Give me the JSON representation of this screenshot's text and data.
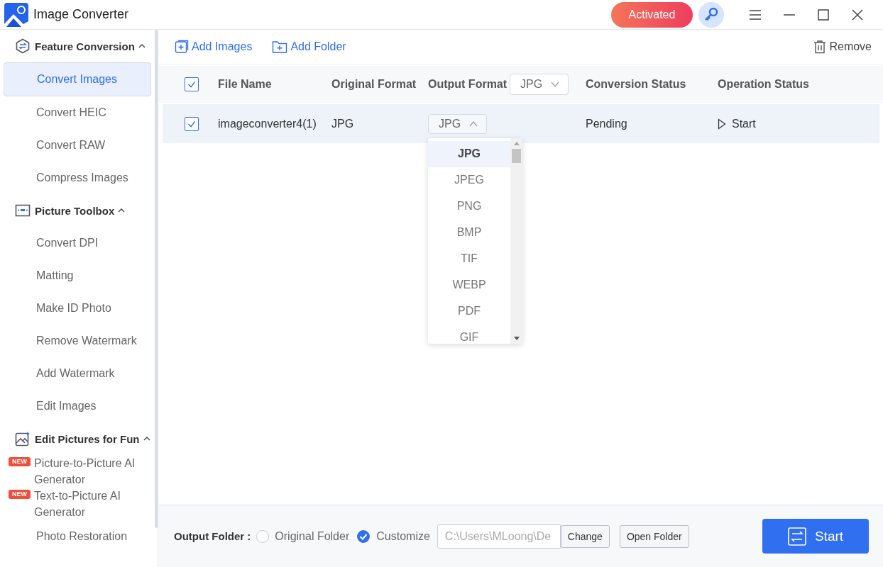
{
  "window": {
    "title": "Image Converter",
    "activated_label": "Activated"
  },
  "sidebar": {
    "sections": [
      {
        "title": "Feature Conversion",
        "expanded": true,
        "items": [
          {
            "label": "Convert Images",
            "selected": true
          },
          {
            "label": "Convert HEIC",
            "selected": false
          },
          {
            "label": "Convert RAW",
            "selected": false
          },
          {
            "label": "Compress Images",
            "selected": false
          }
        ]
      },
      {
        "title": "Picture Toolbox",
        "expanded": true,
        "items": [
          {
            "label": "Convert DPI",
            "selected": false
          },
          {
            "label": "Matting",
            "selected": false
          },
          {
            "label": "Make ID Photo",
            "selected": false
          },
          {
            "label": "Remove Watermark",
            "selected": false
          },
          {
            "label": "Add Watermark",
            "selected": false
          },
          {
            "label": "Edit Images",
            "selected": false
          }
        ]
      },
      {
        "title": "Edit Pictures for Fun",
        "expanded": true,
        "items": [
          {
            "label": "Picture-to-Picture AI Generator",
            "selected": false,
            "badge": "NEW"
          },
          {
            "label": "Text-to-Picture AI Generator",
            "selected": false,
            "badge": "NEW"
          },
          {
            "label": "Photo Restoration",
            "selected": false
          }
        ]
      }
    ]
  },
  "toolbar": {
    "add_images": "Add Images",
    "add_folder": "Add Folder",
    "remove": "Remove"
  },
  "table": {
    "all_checked": true,
    "columns": [
      "File Name",
      "Original Format",
      "Output Format",
      "Conversion Status",
      "Operation Status"
    ],
    "output_format_select": "JPG",
    "rows": [
      {
        "checked": true,
        "file_name": "imageconverter4(1)",
        "original_format": "JPG",
        "output_format": "JPG",
        "dropdown_open": true,
        "status": "Pending",
        "operation": "Start"
      }
    ]
  },
  "format_menu": {
    "options": [
      {
        "label": "JPG",
        "selected": true
      },
      {
        "label": "JPEG",
        "selected": false
      },
      {
        "label": "PNG",
        "selected": false
      },
      {
        "label": "BMP",
        "selected": false
      },
      {
        "label": "TIF",
        "selected": false
      },
      {
        "label": "WEBP",
        "selected": false
      },
      {
        "label": "PDF",
        "selected": false
      },
      {
        "label": "GIF",
        "selected": false
      }
    ]
  },
  "footer": {
    "output_folder_label": "Output Folder :",
    "options": [
      {
        "label": "Original Folder",
        "selected": false
      },
      {
        "label": "Customize",
        "selected": true
      }
    ],
    "path": "C:\\Users\\MLoong\\De",
    "change": "Change",
    "open_folder": "Open Folder",
    "start": "Start"
  }
}
